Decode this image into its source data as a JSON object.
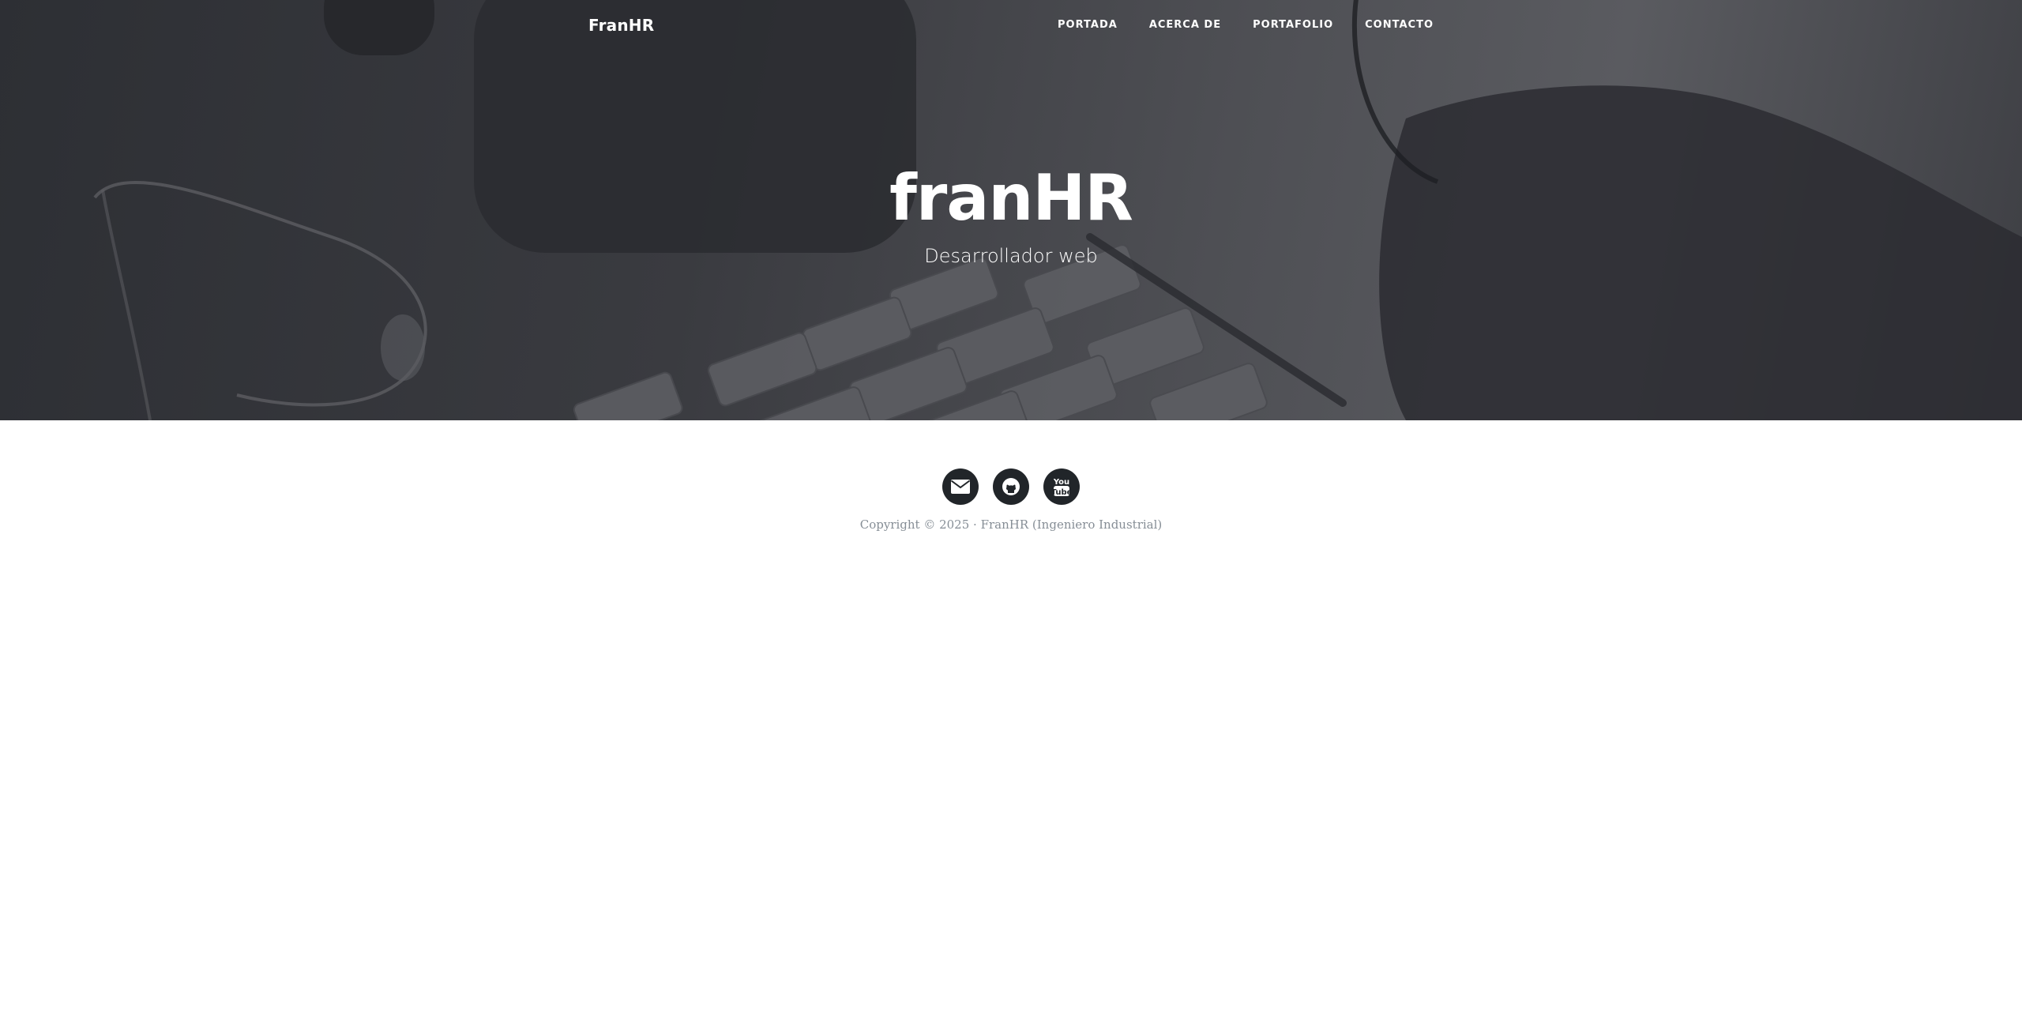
{
  "navbar": {
    "brand": "FranHR",
    "items": [
      {
        "label": "PORTADA"
      },
      {
        "label": "ACERCA DE"
      },
      {
        "label": "PORTAFOLIO"
      },
      {
        "label": "CONTACTO"
      }
    ]
  },
  "hero": {
    "title": "franHR",
    "subtitle": "Desarrollador web"
  },
  "footer": {
    "social": [
      {
        "icon": "envelope-icon"
      },
      {
        "icon": "github-icon"
      },
      {
        "icon": "youtube-icon",
        "text": "You Tube"
      }
    ],
    "copyright": "Copyright © 2025 · FranHR (Ingeniero Industrial)"
  },
  "colors": {
    "hero_overlay": "#3a3b40",
    "icon_circle": "#212529",
    "copyright_text": "#868e96"
  }
}
